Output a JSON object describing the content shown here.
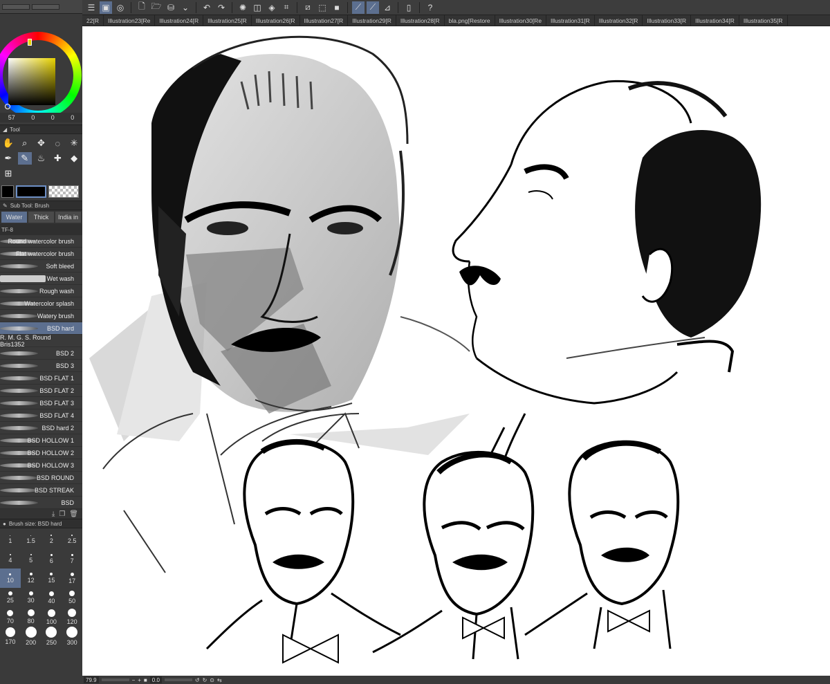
{
  "colors": {
    "accent": "#5c6f8f",
    "panel": "#3a3a3a",
    "main_color": "#e8d300"
  },
  "color_panel": {
    "values": [
      "57",
      "0",
      "0",
      "0"
    ]
  },
  "tool_panel": {
    "title": "Tool"
  },
  "sub_tool": {
    "title": "Sub Tool: Brush",
    "tabs": [
      "Water",
      "Thick",
      "India in"
    ],
    "group_label": "TF-8",
    "brushes": [
      "Round watercolor brush",
      "Flat watercolor brush",
      "Soft bleed",
      "Wet wash",
      "Rough wash",
      "Watercolor splash",
      "Watery brush",
      "BSD hard",
      "R. M. G. S. Round Bris1352",
      "BSD 2",
      "BSD 3",
      "BSD FLAT 1",
      "BSD FLAT 2",
      "BSD FLAT 3",
      "BSD FLAT 4",
      "BSD hard 2",
      "BSD HOLLOW 1",
      "BSD HOLLOW 2",
      "BSD HOLLOW 3",
      "BSD ROUND",
      "BSD STREAK",
      "BSD"
    ],
    "selected": "BSD hard"
  },
  "brush_size": {
    "title": "Brush size: BSD hard",
    "sizes": [
      "1",
      "1.5",
      "2",
      "2.5",
      "4",
      "5",
      "6",
      "7",
      "10",
      "12",
      "15",
      "17",
      "25",
      "30",
      "40",
      "50",
      "70",
      "80",
      "100",
      "120",
      "170",
      "200",
      "250",
      "300"
    ],
    "selected": "10"
  },
  "file_tabs": [
    "22[R",
    "Illustration23[Re",
    "Illustration24[R",
    "Illustration25[R",
    "Illustration26[R",
    "Illustration27[R",
    "Illustration29[R",
    "Illustration28[R",
    "bla.png[Restore",
    "Illustration30[Re",
    "Illustration31[R",
    "Illustration32[R",
    "Illustration33[R",
    "Illustration34[R",
    "Illustration35[R"
  ],
  "status": {
    "zoom": "79.9",
    "angle": "0.0"
  }
}
